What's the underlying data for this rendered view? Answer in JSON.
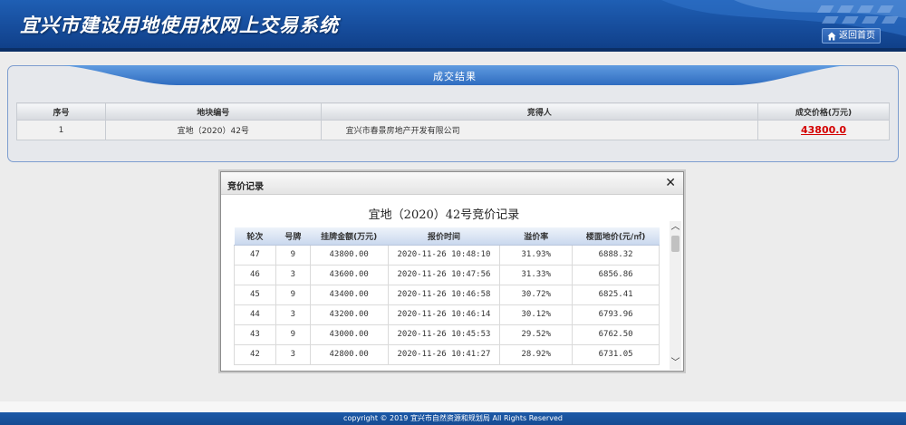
{
  "header": {
    "title": "宜兴市建设用地使用权网上交易系统",
    "home_label": "返回首页",
    "home_icon": "home-icon"
  },
  "result": {
    "banner_title": "成交结果",
    "columns": [
      "序号",
      "地块编号",
      "竞得人",
      "成交价格(万元)"
    ],
    "rows": [
      {
        "index": "1",
        "parcel": "宜地（2020）42号",
        "winner": "宜兴市春景房地产开发有限公司",
        "price": "43800.0"
      }
    ]
  },
  "dialog": {
    "title": "竞价记录",
    "close_icon": "close-icon",
    "heading": "宜地（2020）42号竞价记录",
    "columns": [
      "轮次",
      "号牌",
      "挂牌金额(万元)",
      "报价时间",
      "溢价率",
      "楼面地价(元/㎡)"
    ],
    "rows": [
      {
        "round": "47",
        "plate": "9",
        "amount": "43800.00",
        "time": "2020-11-26 10:48:10",
        "premium": "31.93%",
        "floor_price": "6888.32"
      },
      {
        "round": "46",
        "plate": "3",
        "amount": "43600.00",
        "time": "2020-11-26 10:47:56",
        "premium": "31.33%",
        "floor_price": "6856.86"
      },
      {
        "round": "45",
        "plate": "9",
        "amount": "43400.00",
        "time": "2020-11-26 10:46:58",
        "premium": "30.72%",
        "floor_price": "6825.41"
      },
      {
        "round": "44",
        "plate": "3",
        "amount": "43200.00",
        "time": "2020-11-26 10:46:14",
        "premium": "30.12%",
        "floor_price": "6793.96"
      },
      {
        "round": "43",
        "plate": "9",
        "amount": "43000.00",
        "time": "2020-11-26 10:45:53",
        "premium": "29.52%",
        "floor_price": "6762.50"
      },
      {
        "round": "42",
        "plate": "3",
        "amount": "42800.00",
        "time": "2020-11-26 10:41:27",
        "premium": "28.92%",
        "floor_price": "6731.05"
      }
    ]
  },
  "footer": {
    "copyright": "copyright © 2019 宜兴市自然资源和规划局 All Rights Reserved"
  },
  "colors": {
    "header_blue": "#164c9b",
    "price_red": "#d40000",
    "panel_border": "#7d9dcf"
  }
}
